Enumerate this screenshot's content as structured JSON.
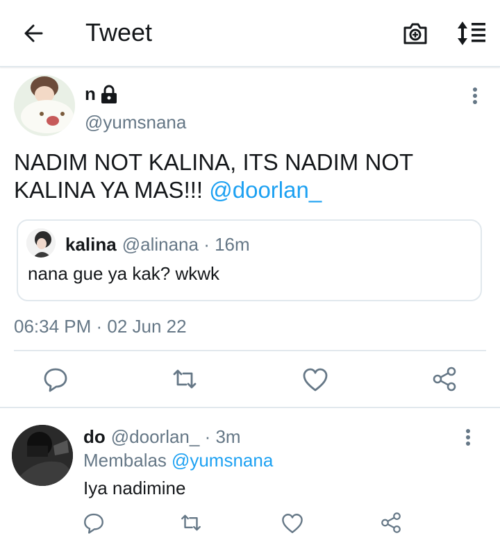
{
  "header": {
    "title": "Tweet",
    "back_icon": "arrow-left-icon",
    "camera_icon": "camera-plus-icon",
    "sort_icon": "sort-toggle-icon"
  },
  "tweet": {
    "name": "n",
    "handle": "@yumsnana",
    "text": "NADIM NOT KALINA, ITS NADIM NOT KALINA YA MAS!!! ",
    "mention": "@doorlan_",
    "timestamp": "06:34 PM · 02 Jun 22"
  },
  "quote": {
    "name": "kalina",
    "handle_time": "@alinana · 16m",
    "text": "nana gue ya kak? wkwk"
  },
  "reply": {
    "name": "do",
    "handle_time": "@doorlan_ · 3m",
    "replying_label": "Membalas",
    "replying_to": "@yumsnana",
    "text": "Iya nadimine"
  },
  "colors": {
    "accent": "#1da1f2",
    "muted": "#657786",
    "text": "#14171a",
    "border": "#e1e8ed"
  }
}
